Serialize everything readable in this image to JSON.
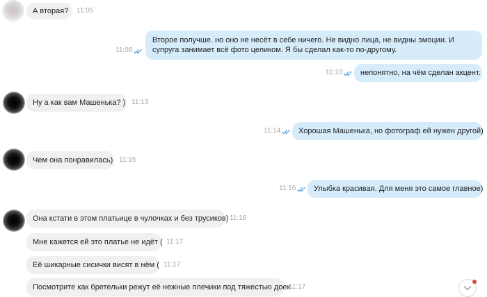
{
  "messages": [
    {
      "dir": "in",
      "text": "А вторая?",
      "time": "11:05"
    },
    {
      "dir": "out",
      "text": "Второе получше. но оно не несёт в себе ничего. Не видно лица, не видны эмоции. И супруга занимает всё фото целиком. Я бы сделал как-то по-другому.",
      "time": "11:08"
    },
    {
      "dir": "out",
      "text": "непонятно, на чём сделан акцент.",
      "time": "11:10"
    },
    {
      "dir": "in",
      "text": "Ну а как вам Машенька? )",
      "time": "11:13"
    },
    {
      "dir": "out",
      "text": "Хорошая Машенька, но фотограф ей нужен другой)",
      "time": "11:14"
    },
    {
      "dir": "in",
      "text": "Чем она понравилась)",
      "time": "11:15"
    },
    {
      "dir": "out",
      "text": "Улыбка красивая. Для меня это самое главное)",
      "time": "11:16"
    },
    {
      "dir": "in",
      "text": "Она кстати в этом платьице в чулочках и без трусиков)",
      "time": "11:16"
    },
    {
      "dir": "in",
      "text": "Мне кажется ей это платье не идёт (",
      "time": "11:17"
    },
    {
      "dir": "in",
      "text": "Её шикарные сисички висят в нём (",
      "time": "11:17"
    },
    {
      "dir": "in",
      "text": "Посмотрите как бретельки режут её нежные плечики под тяжестью доек",
      "time": "11:17"
    }
  ],
  "colors": {
    "incoming_bubble": "#f0f0f0",
    "outgoing_bubble": "#d6ecfb",
    "read_tick": "#4a9fe0",
    "timestamp": "#a6a6a6",
    "unread_badge": "#e0453a"
  },
  "icons": {
    "read_status": "double-check-icon",
    "scroll_down": "chevron-down-icon"
  }
}
